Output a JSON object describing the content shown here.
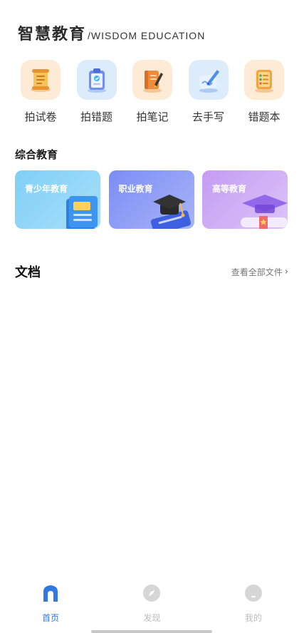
{
  "header": {
    "title": "智慧教育",
    "subtitle": "/WISDOM EDUCATION"
  },
  "tools": [
    {
      "label": "拍试卷",
      "icon": "scroll-icon"
    },
    {
      "label": "拍错题",
      "icon": "clipboard-check-icon"
    },
    {
      "label": "拍笔记",
      "icon": "notebook-pencil-icon"
    },
    {
      "label": "去手写",
      "icon": "handwriting-pen-icon"
    },
    {
      "label": "错题本",
      "icon": "list-book-icon"
    }
  ],
  "section": {
    "title": "综合教育"
  },
  "cards": [
    {
      "label": "青少年教育",
      "icon": "book-icon"
    },
    {
      "label": "职业教育",
      "icon": "graduation-cap-icon"
    },
    {
      "label": "高等教育",
      "icon": "diploma-icon"
    }
  ],
  "documents": {
    "title": "文档",
    "view_all": "查看全部文件"
  },
  "tabbar": [
    {
      "label": "首页",
      "icon": "home-icon",
      "active": true
    },
    {
      "label": "发现",
      "icon": "compass-icon",
      "active": false
    },
    {
      "label": "我的",
      "icon": "profile-icon",
      "active": false
    }
  ],
  "colors": {
    "accent": "#2f79e0",
    "inactive": "#bbbbbb"
  }
}
